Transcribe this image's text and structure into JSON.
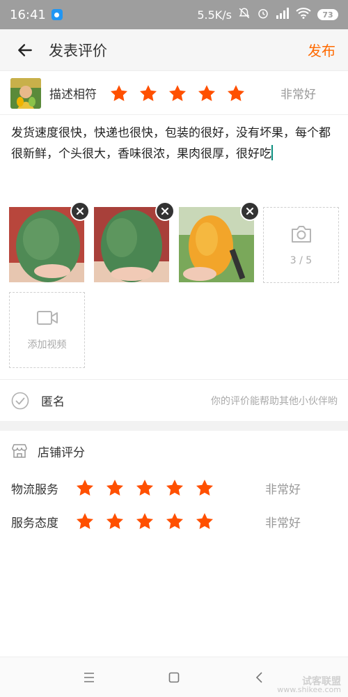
{
  "status_bar": {
    "time": "16:41",
    "speed": "5.5K/s",
    "battery": "73"
  },
  "nav": {
    "title": "发表评价",
    "publish_label": "发布"
  },
  "description_rating": {
    "label": "描述相符",
    "stars": 5,
    "level": "非常好"
  },
  "review": {
    "text": "发货速度很快，快递也很快，包装的很好，没有坏果，每个都很新鲜，个头很大，香味很浓，果肉很厚，很好吃"
  },
  "photos": {
    "count_label": "3 / 5",
    "add_video_label": "添加视频"
  },
  "anonymous": {
    "label": "匿名",
    "hint": "你的评价能帮助其他小伙伴哟"
  },
  "shop_rating": {
    "title": "店铺评分",
    "rows": [
      {
        "label": "物流服务",
        "stars": 5,
        "level": "非常好"
      },
      {
        "label": "服务态度",
        "stars": 5,
        "level": "非常好"
      }
    ]
  },
  "watermark": {
    "line1": "试客联盟",
    "line2": "www.shikee.com"
  },
  "colors": {
    "accent": "#ff6a00",
    "star": "#ff5000",
    "status_bar": "#9e9e9e"
  }
}
